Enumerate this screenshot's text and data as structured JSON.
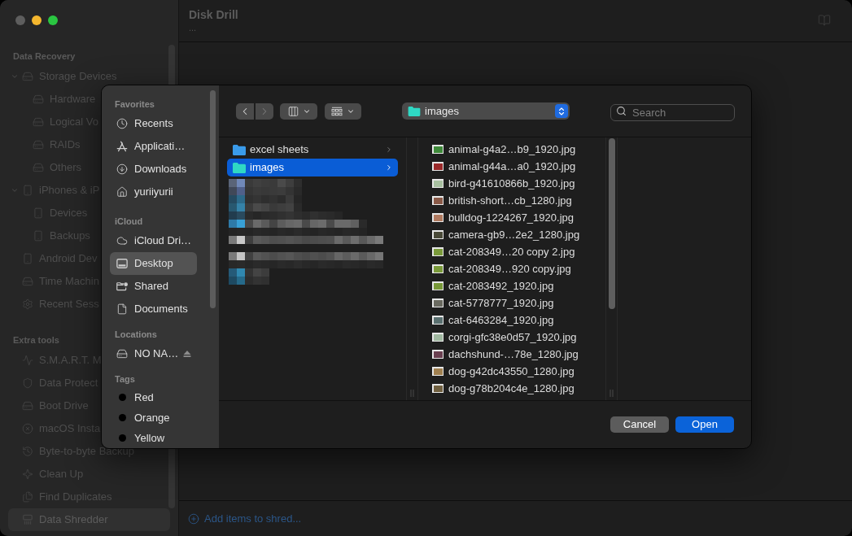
{
  "window": {
    "controls": [
      {
        "color": "#5e5e5e"
      },
      {
        "color": "#f4b62e"
      },
      {
        "color": "#2ac641"
      }
    ]
  },
  "sidebar": {
    "sections": [
      {
        "title": "Data Recovery",
        "items": [
          {
            "label": "Storage Devices",
            "selected": false,
            "expanded": true,
            "children": [
              {
                "label": "Hardware",
                "selected": false
              },
              {
                "label": "Logical Vo",
                "selected": false
              },
              {
                "label": "RAIDs",
                "selected": false
              },
              {
                "label": "Others",
                "selected": false
              }
            ]
          },
          {
            "label": "iPhones & iP",
            "selected": false,
            "expanded": true,
            "children": [
              {
                "label": "Devices",
                "selected": false
              },
              {
                "label": "Backups",
                "selected": false
              }
            ]
          },
          {
            "label": "Android Dev",
            "selected": false
          },
          {
            "label": "Time Machin",
            "selected": false
          },
          {
            "label": "Recent Sess",
            "selected": false
          }
        ]
      },
      {
        "title": "Extra tools",
        "items": [
          {
            "label": "S.M.A.R.T. M",
            "selected": false
          },
          {
            "label": "Data Protect",
            "selected": false
          },
          {
            "label": "Boot Drive",
            "selected": false
          },
          {
            "label": "macOS Insta",
            "selected": false
          },
          {
            "label": "Byte-to-byte Backup",
            "selected": false
          },
          {
            "label": "Clean Up",
            "selected": false
          },
          {
            "label": "Find Duplicates",
            "selected": false
          },
          {
            "label": "Data Shredder",
            "selected": true
          }
        ]
      }
    ]
  },
  "header": {
    "title": "Disk Drill",
    "subtitle": "..."
  },
  "footer": {
    "link": "Add items to shred..."
  },
  "dialog": {
    "sidebar": {
      "sections": [
        {
          "title": "Favorites",
          "kind": "places",
          "items": [
            {
              "label": "Recents",
              "selected": false
            },
            {
              "label": "Applicati…",
              "selected": false
            },
            {
              "label": "Downloads",
              "selected": false
            },
            {
              "label": "yuriiyurii",
              "selected": false
            }
          ]
        },
        {
          "title": "iCloud",
          "kind": "places",
          "items": [
            {
              "label": "iCloud Dri…",
              "selected": false
            },
            {
              "label": "Desktop",
              "selected": true
            },
            {
              "label": "Shared",
              "selected": false
            },
            {
              "label": "Documents",
              "selected": false
            }
          ]
        },
        {
          "title": "Locations",
          "kind": "volumes",
          "items": [
            {
              "label": "NO NA…",
              "selected": false
            }
          ]
        },
        {
          "title": "Tags",
          "kind": "tags",
          "items": [
            {
              "label": "Red",
              "selected": false
            },
            {
              "label": "Orange",
              "selected": false
            },
            {
              "label": "Yellow",
              "selected": false
            }
          ]
        }
      ]
    },
    "toolbar": {
      "back": {
        "disabled": false
      },
      "forward": {
        "disabled": true
      },
      "path": "images",
      "search": {
        "placeholder": "Search"
      }
    },
    "columns": [
      {
        "items": [
          {
            "label": "excel sheets",
            "selected": false,
            "color": "#3a9bea"
          },
          {
            "label": "images",
            "selected": true,
            "color": "#2fd8c4"
          }
        ]
      },
      {
        "items": [
          {
            "label": "animal-g4a2…b9_1920.jpg",
            "selected": false,
            "color": "#3f8a3a"
          },
          {
            "label": "animal-g44a…a0_1920.jpg",
            "selected": false,
            "color": "#9a2a2a"
          },
          {
            "label": "bird-g41610866b_1920.jpg",
            "selected": false,
            "color": "#a8c0a0"
          },
          {
            "label": "british-short…cb_1280.jpg",
            "selected": false,
            "color": "#8a5a48"
          },
          {
            "label": "bulldog-1224267_1920.jpg",
            "selected": false,
            "color": "#b07a60"
          },
          {
            "label": "camera-gb9…2e2_1280.jpg",
            "selected": false,
            "color": "#4a4a38"
          },
          {
            "label": "cat-208349…20 copy 2.jpg",
            "selected": false,
            "color": "#7a9a3a"
          },
          {
            "label": "cat-208349…920 copy.jpg",
            "selected": false,
            "color": "#7a9a3a"
          },
          {
            "label": "cat-2083492_1920.jpg",
            "selected": false,
            "color": "#789838"
          },
          {
            "label": "cat-5778777_1920.jpg",
            "selected": false,
            "color": "#6a6a60"
          },
          {
            "label": "cat-6463284_1920.jpg",
            "selected": false,
            "color": "#5a7070"
          },
          {
            "label": "corgi-gfc38e0d57_1920.jpg",
            "selected": false,
            "color": "#a0b8a0"
          },
          {
            "label": "dachshund-…78e_1280.jpg",
            "selected": false,
            "color": "#6a4050"
          },
          {
            "label": "dog-g42dc43550_1280.jpg",
            "selected": false,
            "color": "#a08050"
          },
          {
            "label": "dog-g78b204c4e_1280.jpg",
            "selected": false,
            "color": "#706040"
          }
        ]
      }
    ],
    "buttons": [
      {
        "label": "Cancel",
        "kind": "secondary"
      },
      {
        "label": "Open",
        "kind": "primary"
      }
    ]
  }
}
